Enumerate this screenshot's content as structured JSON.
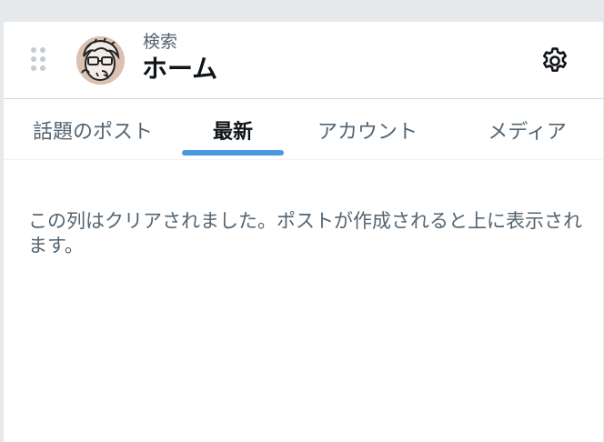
{
  "header": {
    "subtitle": "検索",
    "title": "ホーム"
  },
  "tabs": [
    {
      "label": "話題のポスト",
      "active": false
    },
    {
      "label": "最新",
      "active": true
    },
    {
      "label": "アカウント",
      "active": false
    },
    {
      "label": "メディア",
      "active": false
    }
  ],
  "empty_message": "この列はクリアされました。ポストが作成されると上に表示されます。",
  "icons": {
    "drag": "drag-handle-icon",
    "settings": "gear-icon",
    "avatar": "avatar"
  },
  "colors": {
    "accent": "#4a98e0",
    "text_primary": "#0f1419",
    "text_secondary": "#536471"
  }
}
